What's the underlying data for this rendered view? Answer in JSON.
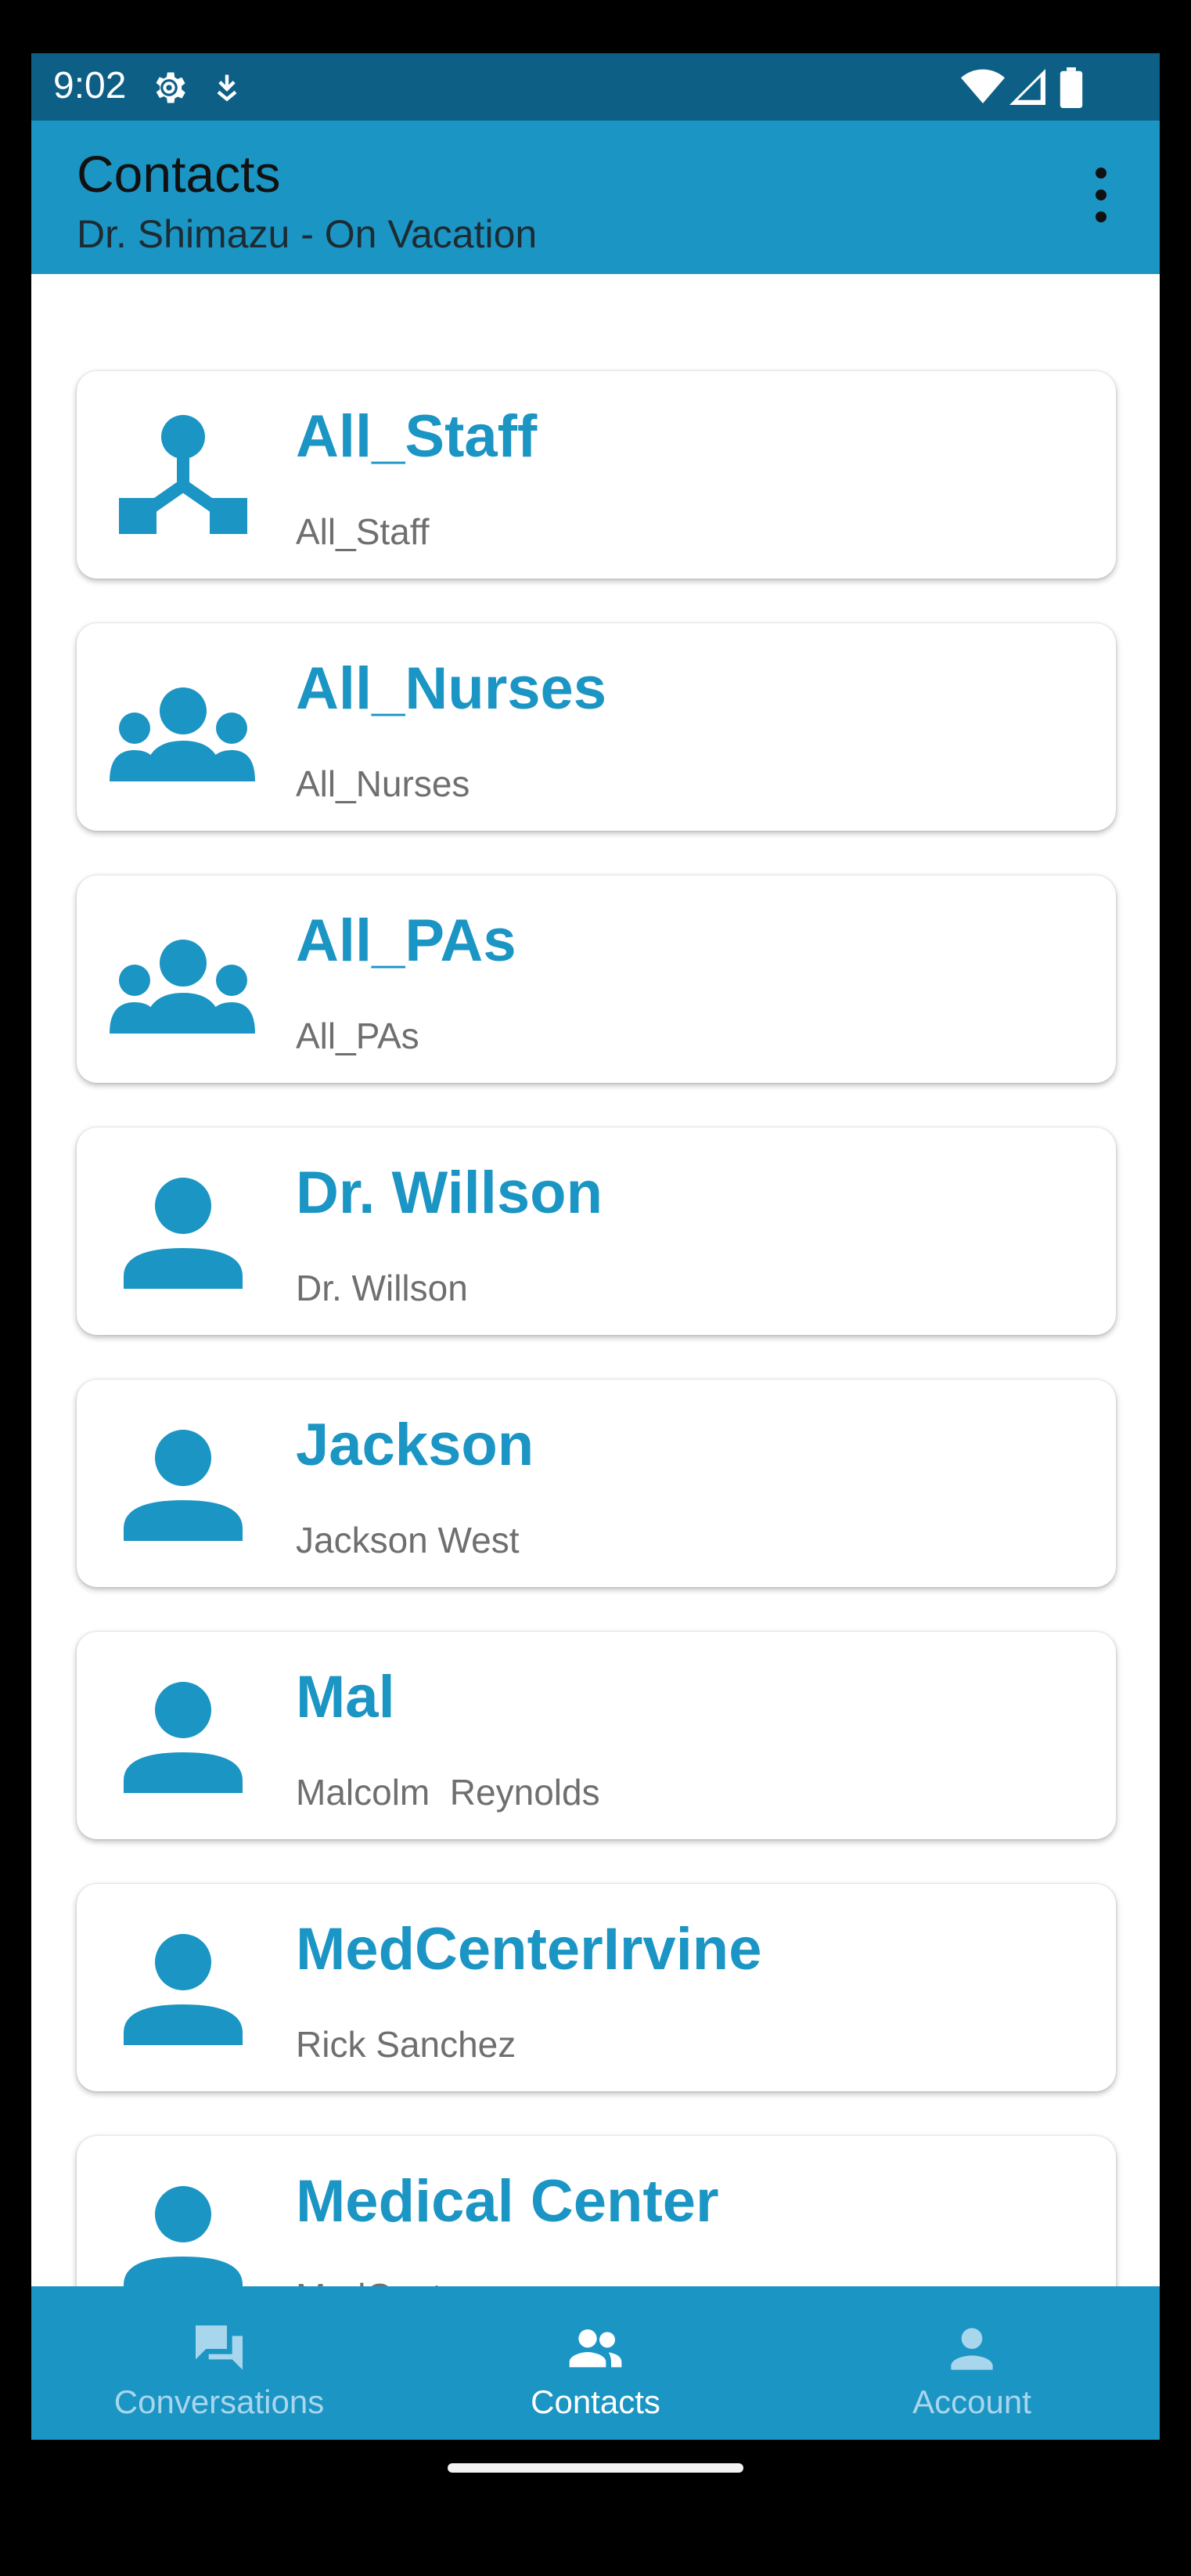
{
  "status_bar": {
    "time": "9:02",
    "icons": [
      "settings-icon",
      "download-icon",
      "wifi-icon",
      "signal-icon",
      "battery-icon"
    ]
  },
  "app_bar": {
    "title": "Contacts",
    "subtitle": "Dr. Shimazu - On Vacation",
    "menu_icon": "more-vert-icon"
  },
  "contacts": [
    {
      "title": "All_Staff",
      "subtitle": "All_Staff",
      "icon": "org-chart-icon"
    },
    {
      "title": "All_Nurses",
      "subtitle": "All_Nurses",
      "icon": "group-icon"
    },
    {
      "title": "All_PAs",
      "subtitle": "All_PAs",
      "icon": "group-icon"
    },
    {
      "title": "Dr. Willson",
      "subtitle": "Dr. Willson",
      "icon": "person-icon"
    },
    {
      "title": "Jackson",
      "subtitle": "Jackson West",
      "icon": "person-icon"
    },
    {
      "title": "Mal",
      "subtitle": "Malcolm  Reynolds",
      "icon": "person-icon"
    },
    {
      "title": "MedCenterIrvine",
      "subtitle": "Rick Sanchez",
      "icon": "person-icon"
    },
    {
      "title": "Medical Center",
      "subtitle": "MedCenter",
      "icon": "person-icon"
    }
  ],
  "bottom_nav": {
    "items": [
      {
        "label": "Conversations",
        "icon": "forum-icon",
        "active": false
      },
      {
        "label": "Contacts",
        "icon": "people-icon",
        "active": true
      },
      {
        "label": "Account",
        "icon": "account-icon",
        "active": false
      }
    ]
  },
  "colors": {
    "primary": "#1b95c4",
    "status_bar": "#0d5f86",
    "nav_inactive": "#a8d6ec",
    "subtitle_text": "#6f6f6f"
  }
}
